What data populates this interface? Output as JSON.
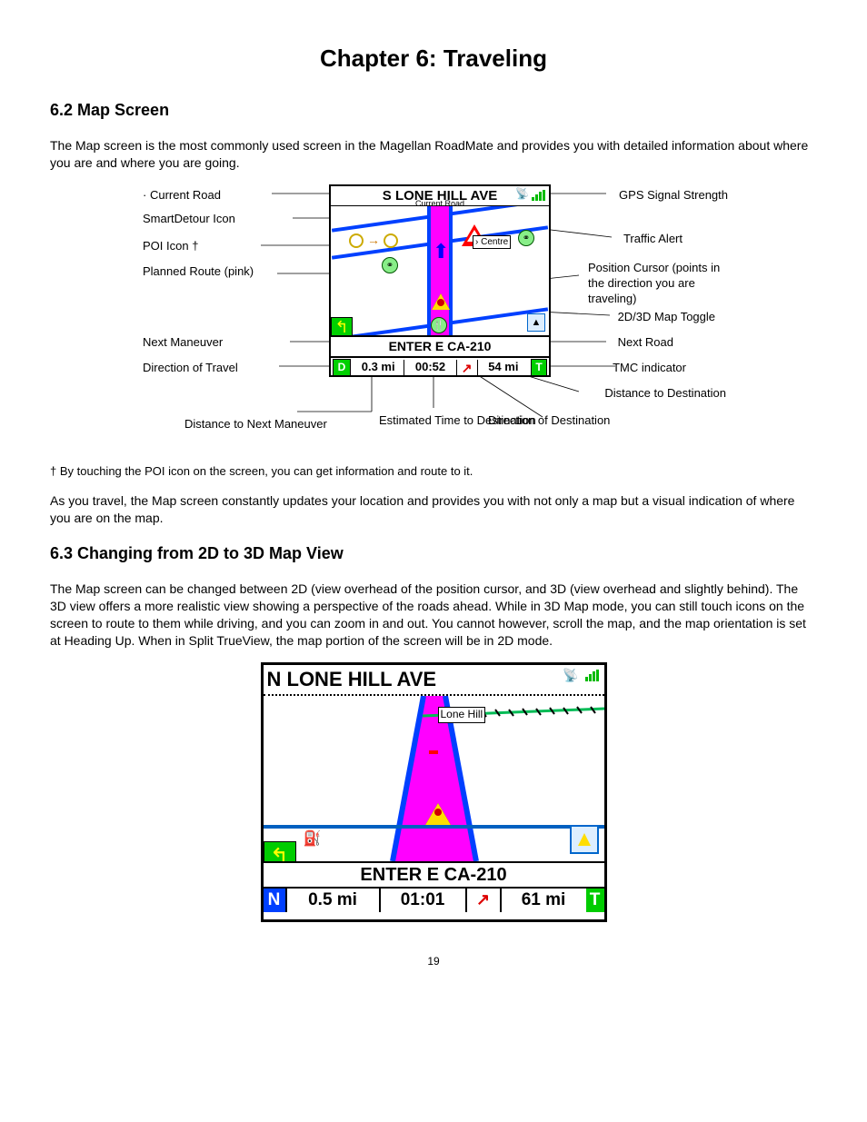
{
  "chapter_title": "Chapter 6: Traveling",
  "section_62_heading": "6.2 Map Screen",
  "para_62": "The Map screen is the most commonly used screen in the Magellan RoadMate and provides you with detailed information about where you are and where you are going.",
  "footnote": "† By touching the POI icon on the screen, you can get information and route to it.",
  "para_62b": "As you travel, the Map screen constantly updates your location and provides you with not only a map but a visual indication of where you are on the map.",
  "section_63_heading": "6.3 Changing from 2D to 3D Map View",
  "para_63": "The Map screen can be changed between 2D (view overhead of the position cursor, and 3D (view overhead and slightly behind). The 3D view offers a more realistic view showing a perspective of the roads ahead. While in 3D Map mode, you can still touch icons on the screen to route to them while driving, and you can zoom in and out. You cannot however, scroll the map, and the map orientation is set at Heading Up. When in Split TrueView, the map portion of the screen will be in 2D mode.",
  "page_number": "19",
  "labels": {
    "current_road": "Current Road",
    "smartdetour": "SmartDetour Icon",
    "poi_icon": "POI Icon †",
    "planned_route": "Planned Route (pink)",
    "next_maneuver": "Next Maneuver",
    "direction_travel": "Direction of Travel",
    "dist_next_maneuver": "Distance to Next Maneuver",
    "eta": "Estimated Time to Destination",
    "gps": "GPS Signal Strength",
    "traffic": "Traffic Alert",
    "pos_cursor": "Position Cursor (points in the direction you are traveling)",
    "toggle": "2D/3D Map Toggle",
    "next_road": "Next Road",
    "tmc": "TMC indicator",
    "dist_dest": "Distance to Destination",
    "dir_dest": "Direction of Destination"
  },
  "gps1": {
    "current_road": "S LONE HILL AVE",
    "current_road_sub": "Current Road",
    "street_centre": "Centre",
    "next_road": "ENTER E CA-210",
    "dir_letter": "D",
    "dist_next": "0.3 mi",
    "time": "00:52",
    "dist_dest": "54 mi",
    "tmc_letter": "T"
  },
  "gps2": {
    "current_road": "N LONE HILL AVE",
    "street_lonehill": "Lone Hill",
    "next_road": "ENTER E CA-210",
    "dir_letter": "N",
    "dist_next": "0.5 mi",
    "time": "01:01",
    "dist_dest": "61 mi",
    "tmc_letter": "T"
  }
}
